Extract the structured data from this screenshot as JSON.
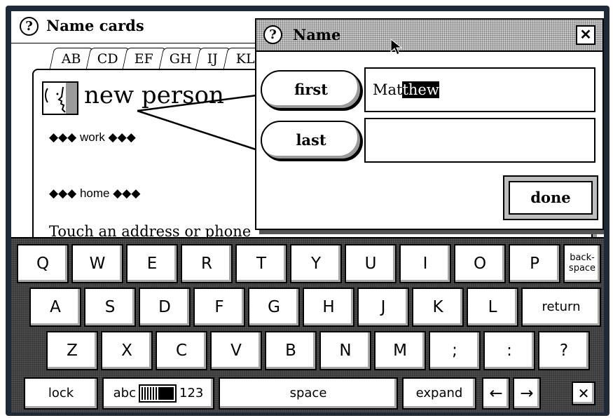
{
  "app": {
    "help_glyph": "?",
    "title": "Name cards",
    "tabs": [
      "AB",
      "CD",
      "EF",
      "GH",
      "IJ",
      "KL"
    ],
    "card": {
      "person_name": "new person",
      "work_label": "◆◆◆ work ◆◆◆",
      "home_label": "◆◆◆ home ◆◆◆",
      "hint": "Touch an address or phone"
    }
  },
  "dialog": {
    "help_glyph": "?",
    "title": "Name",
    "close_glyph": "✕",
    "first_label": "first",
    "first_value_plain": "Mat",
    "first_value_selected": "thew",
    "last_label": "last",
    "last_value": "",
    "done_label": "done"
  },
  "keyboard": {
    "row1": [
      "Q",
      "W",
      "E",
      "R",
      "T",
      "Y",
      "U",
      "I",
      "O",
      "P"
    ],
    "backspace_line1": "back-",
    "backspace_line2": "space",
    "row2": [
      "A",
      "S",
      "D",
      "F",
      "G",
      "H",
      "J",
      "K",
      "L"
    ],
    "return_label": "return",
    "row3": [
      "Z",
      "X",
      "C",
      "V",
      "B",
      "N",
      "M",
      ";",
      ":",
      "?"
    ],
    "lock_label": "lock",
    "mode_left": "abc",
    "mode_right": "123",
    "space_label": "space",
    "expand_label": "expand",
    "left_arrow": "←",
    "right_arrow": "→",
    "close_glyph": "✕"
  }
}
